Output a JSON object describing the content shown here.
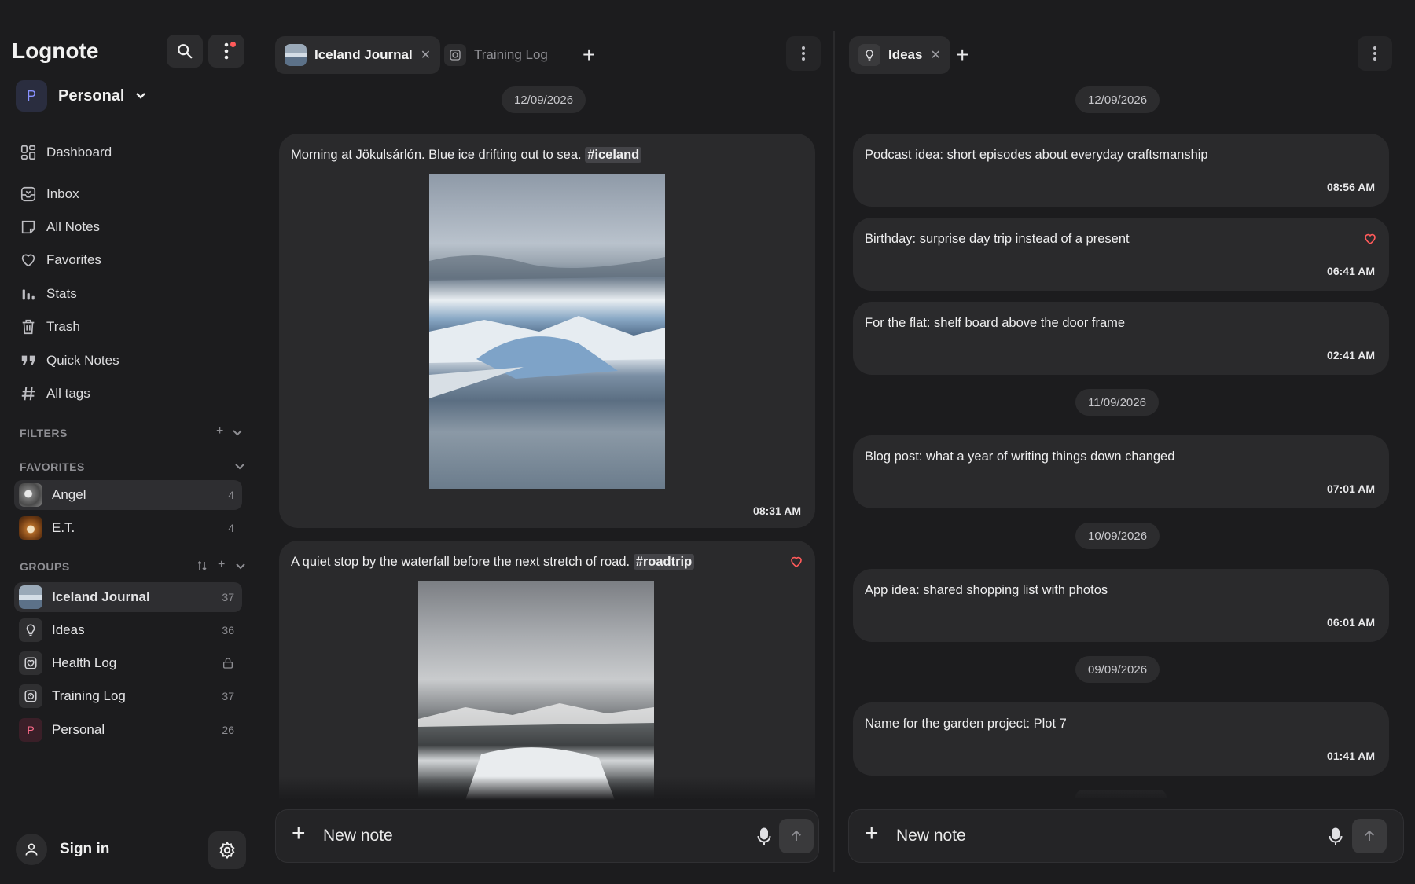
{
  "app": {
    "name": "Lognote"
  },
  "workspace": {
    "initial": "P",
    "name": "Personal"
  },
  "nav": [
    {
      "label": "Dashboard",
      "icon": "dashboard-icon"
    },
    {
      "label": "Inbox",
      "icon": "inbox-icon"
    },
    {
      "label": "All Notes",
      "icon": "notes-icon"
    },
    {
      "label": "Favorites",
      "icon": "heart-icon"
    },
    {
      "label": "Stats",
      "icon": "stats-icon"
    },
    {
      "label": "Trash",
      "icon": "trash-icon"
    },
    {
      "label": "Quick Notes",
      "icon": "quote-icon"
    },
    {
      "label": "All tags",
      "icon": "hash-icon"
    }
  ],
  "sections": {
    "filters": "FILTERS",
    "favorites": "FAVORITES",
    "groups": "GROUPS"
  },
  "favorites": [
    {
      "name": "Angel",
      "count": "4"
    },
    {
      "name": "E.T.",
      "count": "4"
    }
  ],
  "groups": [
    {
      "name": "Iceland Journal",
      "count": "37"
    },
    {
      "name": "Ideas",
      "count": "36"
    },
    {
      "name": "Health Log",
      "count": ""
    },
    {
      "name": "Training Log",
      "count": "37"
    },
    {
      "name": "Personal",
      "count": "26",
      "initial": "P"
    }
  ],
  "footer": {
    "signin": "Sign in"
  },
  "left_pane": {
    "tabs": [
      {
        "label": "Iceland Journal",
        "active": true
      },
      {
        "label": "Training Log",
        "active": false
      }
    ],
    "date": "12/09/2026",
    "notes": [
      {
        "text": "Morning at Jökulsárlón. Blue ice drifting out to sea.",
        "tag": "#iceland",
        "time": "08:31 AM"
      },
      {
        "text": "A quiet stop by the waterfall before the next stretch of road.",
        "tag": "#roadtrip"
      }
    ],
    "composer_placeholder": "New note"
  },
  "right_pane": {
    "tabs": [
      {
        "label": "Ideas",
        "active": true
      }
    ],
    "dates": [
      "12/09/2026",
      "11/09/2026",
      "10/09/2026",
      "09/09/2026"
    ],
    "notes": [
      {
        "text": "Podcast idea: short episodes about everyday craftsmanship",
        "time": "08:56 AM"
      },
      {
        "text": "Birthday: surprise day trip instead of a present",
        "time": "06:41 AM"
      },
      {
        "text": "For the flat: shelf board above the door frame",
        "time": "02:41 AM"
      },
      {
        "text": "Blog post: what a year of writing things down changed",
        "time": "07:01 AM"
      },
      {
        "text": "App idea: shared shopping list with photos",
        "time": "06:01 AM"
      },
      {
        "text": "Name for the garden project: Plot 7",
        "time": "01:41 AM"
      }
    ],
    "composer_placeholder": "New note"
  },
  "colors": {
    "accent": "#8891ff",
    "heart": "#ff5a5a",
    "background": "#1c1c1e",
    "card": "#2a2a2c"
  }
}
